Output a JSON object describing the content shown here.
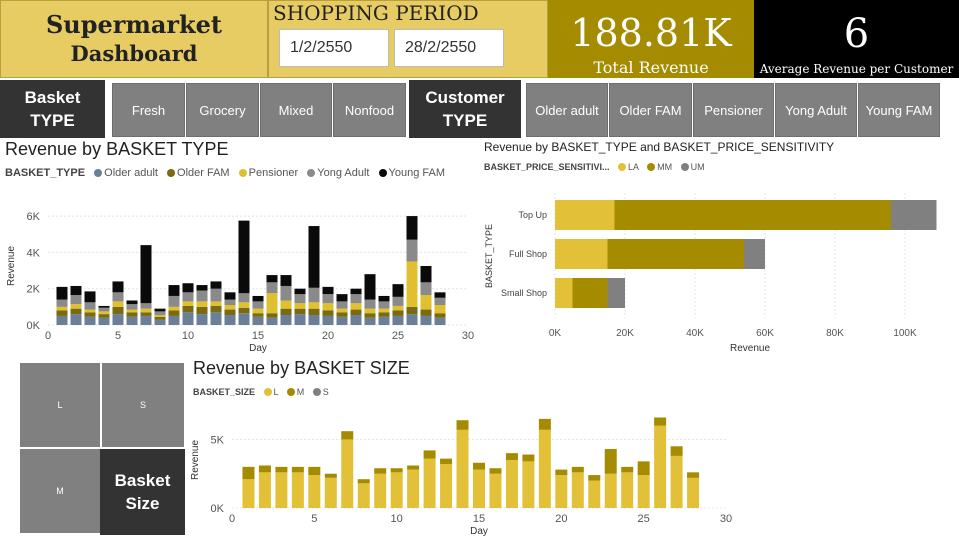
{
  "header": {
    "title_line1": "Supermarket",
    "title_line2": "Dashboard",
    "period_title": "SHOPPING PERIOD",
    "date_start": "1/2/2550",
    "date_end": "28/2/2550",
    "total_revenue_value": "188.81K",
    "total_revenue_label": "Total Revenue",
    "avg_value": "6",
    "avg_label": "Average Revenue per Customer"
  },
  "slicers": {
    "basket_label_1": "Basket",
    "basket_label_2": "TYPE",
    "basket_items": [
      "Fresh",
      "Grocery",
      "Mixed",
      "Nonfood"
    ],
    "customer_label_1": "Customer",
    "customer_label_2": "TYPE",
    "customer_items": [
      "Older adult",
      "Older FAM",
      "Pensioner",
      "Yong Adult",
      "Young FAM"
    ]
  },
  "chart1_meta": {
    "title": "Revenue by BASKET TYPE",
    "legend_title": "BASKET_TYPE",
    "legend_items": [
      "Older adult",
      "Older FAM",
      "Pensioner",
      "Yong Adult",
      "Young FAM"
    ],
    "xlabel": "Day",
    "ylabel": "Revenue"
  },
  "chart2_meta": {
    "title": "Revenue by BASKET_TYPE and BASKET_PRICE_SENSITIVITY",
    "legend_title": "BASKET_PRICE_SENSITIVI...",
    "legend_items": [
      "LA",
      "MM",
      "UM"
    ],
    "xlabel": "Revenue",
    "ylabel": "BASKET_TYPE"
  },
  "chart3_meta": {
    "title": "Revenue by BASKET SIZE",
    "legend_title": "BASKET_SIZE",
    "legend_items": [
      "L",
      "M",
      "S"
    ],
    "xlabel": "Day",
    "ylabel": "Revenue"
  },
  "treemap": {
    "cells": [
      "L",
      "S",
      "M"
    ],
    "label_1": "Basket",
    "label_2": "Size"
  },
  "colors": {
    "gold": "#e6cc63",
    "dark_gold": "#a58b00",
    "older_adult": "#6b7f98",
    "older_fam": "#7a6a10",
    "pensioner": "#e0c030",
    "yong_adult": "#8a8a8a",
    "young_fam": "#0a0a0a",
    "la": "#e2c038",
    "mm": "#a58b00",
    "um": "#808080"
  },
  "chart_data": [
    {
      "type": "bar",
      "stacked": true,
      "title": "Revenue by BASKET TYPE",
      "xlabel": "Day",
      "ylabel": "Revenue",
      "x": [
        1,
        2,
        3,
        4,
        5,
        6,
        7,
        8,
        9,
        10,
        11,
        12,
        13,
        14,
        15,
        16,
        17,
        18,
        19,
        20,
        21,
        22,
        23,
        24,
        25,
        26,
        27,
        28
      ],
      "xlim": [
        0,
        30
      ],
      "xticks": [
        0,
        5,
        10,
        15,
        20,
        25,
        30
      ],
      "ylim": [
        0,
        6500
      ],
      "yticks": [
        0,
        2000,
        4000,
        6000
      ],
      "ytick_labels": [
        "0K",
        "2K",
        "4K",
        "6K"
      ],
      "series": [
        {
          "name": "Older adult",
          "values": [
            500,
            600,
            450,
            400,
            600,
            450,
            500,
            300,
            500,
            700,
            600,
            700,
            550,
            650,
            450,
            400,
            550,
            600,
            550,
            500,
            450,
            550,
            400,
            450,
            500,
            600,
            500,
            400
          ]
        },
        {
          "name": "Older FAM",
          "values": [
            300,
            300,
            250,
            200,
            400,
            250,
            200,
            150,
            300,
            350,
            400,
            350,
            300,
            300,
            200,
            250,
            350,
            300,
            350,
            300,
            250,
            300,
            250,
            250,
            300,
            400,
            350,
            250
          ]
        },
        {
          "name": "Pensioner",
          "values": [
            200,
            250,
            150,
            150,
            300,
            150,
            200,
            100,
            200,
            250,
            300,
            250,
            250,
            300,
            250,
            1100,
            450,
            300,
            350,
            400,
            200,
            350,
            250,
            200,
            250,
            2500,
            800,
            450
          ]
        },
        {
          "name": "Yong Adult",
          "values": [
            400,
            500,
            400,
            200,
            500,
            300,
            300,
            200,
            600,
            500,
            600,
            700,
            300,
            500,
            400,
            600,
            800,
            500,
            800,
            500,
            400,
            500,
            500,
            400,
            500,
            1200,
            700,
            400
          ]
        },
        {
          "name": "Young FAM",
          "values": [
            700,
            500,
            600,
            100,
            600,
            200,
            3200,
            150,
            600,
            500,
            300,
            400,
            400,
            4000,
            300,
            400,
            600,
            300,
            3400,
            400,
            400,
            300,
            1400,
            300,
            700,
            1300,
            900,
            300
          ]
        }
      ]
    },
    {
      "type": "bar",
      "orientation": "horizontal",
      "stacked": true,
      "title": "Revenue by BASKET_TYPE and BASKET_PRICE_SENSITIVITY",
      "xlabel": "Revenue",
      "ylabel": "BASKET_TYPE",
      "categories": [
        "Top Up",
        "Full Shop",
        "Small Shop"
      ],
      "xlim": [
        0,
        110000
      ],
      "xticks": [
        0,
        20000,
        40000,
        60000,
        80000,
        100000
      ],
      "xtick_labels": [
        "0K",
        "20K",
        "40K",
        "60K",
        "80K",
        "100K"
      ],
      "series": [
        {
          "name": "LA",
          "values": [
            17000,
            15000,
            5000
          ]
        },
        {
          "name": "MM",
          "values": [
            79000,
            39000,
            10000
          ]
        },
        {
          "name": "UM",
          "values": [
            13000,
            6000,
            5000
          ]
        }
      ]
    },
    {
      "type": "bar",
      "stacked": true,
      "title": "Revenue by BASKET SIZE",
      "xlabel": "Day",
      "ylabel": "Revenue",
      "x": [
        1,
        2,
        3,
        4,
        5,
        6,
        7,
        8,
        9,
        10,
        11,
        12,
        13,
        14,
        15,
        16,
        17,
        18,
        19,
        20,
        21,
        22,
        23,
        24,
        25,
        26,
        27,
        28
      ],
      "xlim": [
        0,
        30
      ],
      "xticks": [
        0,
        5,
        10,
        15,
        20,
        25,
        30
      ],
      "ylim": [
        0,
        7000
      ],
      "yticks": [
        0,
        5000
      ],
      "ytick_labels": [
        "0K",
        "5K"
      ],
      "series": [
        {
          "name": "L",
          "values": [
            2100,
            2600,
            2600,
            2600,
            2400,
            2200,
            5000,
            1800,
            2500,
            2600,
            2800,
            3600,
            3200,
            5700,
            2800,
            2500,
            3500,
            3400,
            5700,
            2400,
            2600,
            2000,
            2500,
            2600,
            2400,
            6000,
            3800,
            2200
          ]
        },
        {
          "name": "M",
          "values": [
            900,
            500,
            400,
            400,
            600,
            300,
            600,
            300,
            400,
            300,
            300,
            600,
            400,
            700,
            500,
            400,
            500,
            500,
            800,
            400,
            400,
            400,
            1800,
            400,
            1000,
            600,
            700,
            400
          ]
        },
        {
          "name": "S",
          "values": [
            0,
            0,
            0,
            0,
            0,
            0,
            0,
            0,
            0,
            0,
            0,
            0,
            0,
            0,
            0,
            0,
            0,
            0,
            0,
            0,
            0,
            0,
            0,
            0,
            0,
            0,
            0,
            0
          ]
        }
      ]
    }
  ]
}
